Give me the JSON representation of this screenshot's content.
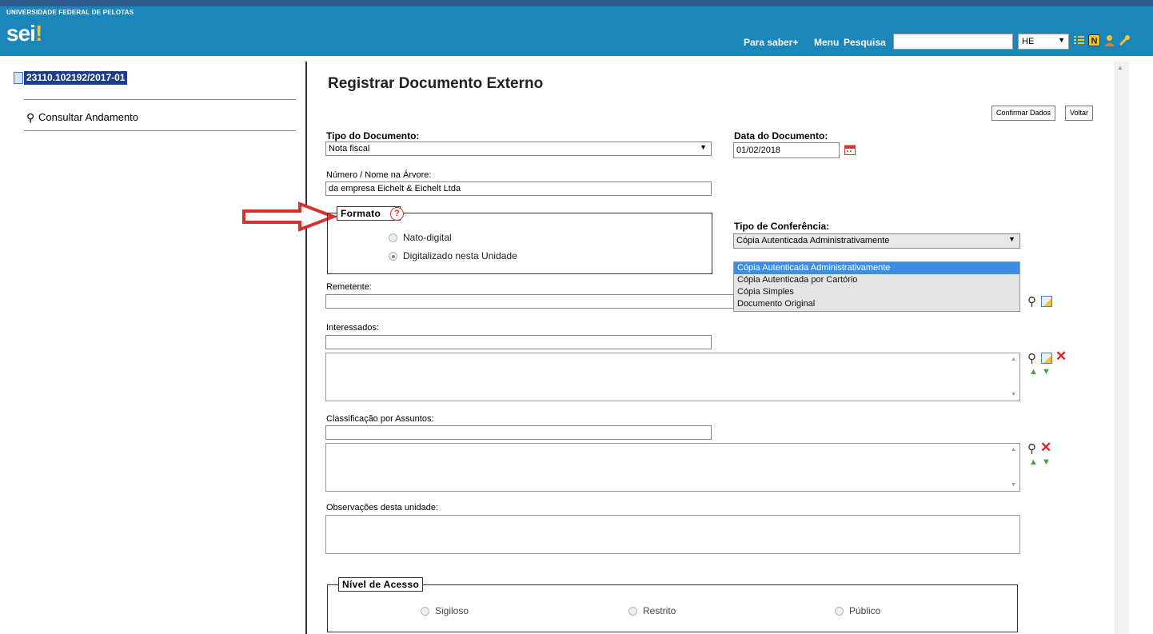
{
  "header": {
    "institution": "UNIVERSIDADE FEDERAL DE PELOTAS",
    "logo": "sei",
    "logo_mark": "!",
    "link_para_saber": "Para saber+",
    "link_menu": "Menu",
    "link_pesquisa": "Pesquisa",
    "search_value": "",
    "unit_value": "HE",
    "icons": [
      "list-icon",
      "notes-icon",
      "user-icon",
      "tools-icon"
    ]
  },
  "sidebar": {
    "process_number": "23110.102192/2017-01",
    "consultar": "Consultar Andamento"
  },
  "form": {
    "title": "Registrar Documento Externo",
    "confirm_button": "Confirmar Dados",
    "back_button": "Voltar",
    "tipo_documento_label": "Tipo do Documento:",
    "tipo_documento_value": "Nota fiscal",
    "data_documento_label": "Data do Documento:",
    "data_documento_value": "01/02/2018",
    "numero_label": "Número / Nome na Árvore:",
    "numero_value": "da empresa Eichelt & Eichelt Ltda",
    "formato_legend": "Formato",
    "formato_help": "?",
    "formato_options": [
      "Nato-digital",
      "Digitalizado nesta Unidade"
    ],
    "formato_selected": "Digitalizado nesta Unidade",
    "tipo_conferencia_label": "Tipo de Conferência:",
    "tipo_conferencia_value": "Cópia Autenticada Administrativamente",
    "tipo_conferencia_options": [
      "Cópia Autenticada Administrativamente",
      "Cópia Autenticada por Cartório",
      "Cópia Simples",
      "Documento Original"
    ],
    "remetente_label": "Remetente:",
    "interessados_label": "Interessados:",
    "classificacao_label": "Classificação por Assuntos:",
    "observacoes_label": "Observações desta unidade:",
    "nivel_acesso_legend": "Nível de Acesso",
    "nivel_acesso_options": [
      "Sigiloso",
      "Restrito",
      "Público"
    ]
  },
  "colors": {
    "header_bg": "#1a86b9",
    "selection_blue": "#3d8de2",
    "arrow_red": "#d3332f"
  }
}
